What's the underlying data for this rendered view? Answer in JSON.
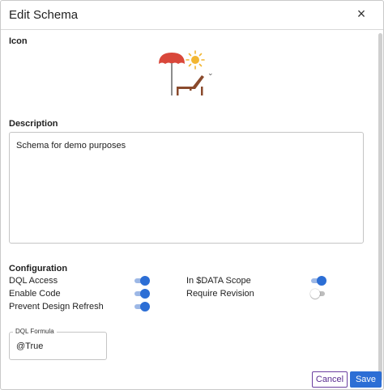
{
  "dialog": {
    "title": "Edit Schema",
    "close_glyph": "×"
  },
  "icon_section": {
    "title": "Icon",
    "selected_icon": "beach-chair-umbrella-sun-icon",
    "colors": {
      "umbrella": "#d9473a",
      "sun": "#f2b632",
      "chair": "#8a4a2c"
    }
  },
  "description_section": {
    "title": "Description",
    "value": "Schema for demo purposes"
  },
  "configuration": {
    "title": "Configuration",
    "options": [
      {
        "label": "DQL Access",
        "enabled": true
      },
      {
        "label": "Enable Code",
        "enabled": true
      },
      {
        "label": "Prevent Design Refresh",
        "enabled": true
      },
      {
        "label": "In $DATA Scope",
        "enabled": true
      },
      {
        "label": "Require Revision",
        "enabled": false
      }
    ]
  },
  "dql_formula": {
    "label": "DQL Formula",
    "value": "@True"
  },
  "footer": {
    "cancel_label": "Cancel",
    "save_label": "Save"
  },
  "colors": {
    "accent": "#2c6ed5",
    "cancel_border": "#6a3fa0"
  }
}
